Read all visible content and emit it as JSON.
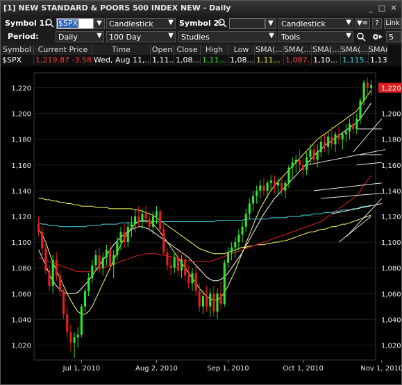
{
  "window": {
    "title": "[1] NEW STANDARD & POORS 500 INDEX NEW - Daily",
    "minimize": "_",
    "maximize": "□",
    "close": "✕"
  },
  "toolbar": {
    "symbol1_label": "Symbol 1:",
    "symbol1_value": "$SPX",
    "chart_type1": "Candlestick",
    "symbol2_label": "Symbol 2:",
    "symbol2_value": "",
    "chart_type2": "Candlestick",
    "link_label": "Link",
    "help_label": "?",
    "period_label": "Period:",
    "period_value": "Daily",
    "range_value": "100 Day",
    "studies_label": "Studies",
    "tools_label": "Tools",
    "count_value": "5"
  },
  "quote": {
    "headers": [
      "Symbol",
      "Current Price",
      "Time",
      "Open",
      "Close",
      "High",
      "Low",
      "SMA(...",
      "SMA(...",
      "SMA(...",
      "SMA(...",
      "SMA(..."
    ],
    "values": [
      "$SPX",
      "1,219.87  -3.58...",
      "Wed, Aug 11,...",
      "1,11...",
      "1,08...",
      "1,11...",
      "1,08...",
      "1,11...",
      "1,087...",
      "1,10...",
      "1,115...",
      "1,13..."
    ],
    "value_colors": [
      "#ffffff",
      "#ff3b3b",
      "#ffffff",
      "#ffffff",
      "#ffffff",
      "#2ee82e",
      "#ffffff",
      "#e8e84a",
      "#ff4040",
      "#ffffff",
      "#3fd8e0",
      "#ffffff"
    ]
  },
  "chart_data": {
    "type": "candlestick",
    "y_ticks": [
      1020,
      1040,
      1060,
      1080,
      1100,
      1120,
      1140,
      1160,
      1180,
      1200,
      1220
    ],
    "y_tick_labels": [
      "1,020",
      "1,040",
      "1,060",
      "1,080",
      "1,100",
      "1,120",
      "1,140",
      "1,160",
      "1,180",
      "1,200",
      "1,220"
    ],
    "ylim": [
      1010,
      1230
    ],
    "x_labels": [
      "Jul 1, 2010",
      "Aug 2, 2010",
      "Sep 1, 2010",
      "Oct 1, 2010",
      "Nov 1, 2010"
    ],
    "x_label_index": [
      12,
      33,
      53,
      74,
      96
    ],
    "last_price_label": "1,220",
    "last_price": 1220,
    "up_color": "#2ee82e",
    "down_color": "#e82020",
    "candles": [
      [
        1114,
        1120,
        1105,
        1108
      ],
      [
        1108,
        1112,
        1090,
        1095
      ],
      [
        1095,
        1100,
        1075,
        1078
      ],
      [
        1078,
        1082,
        1062,
        1066
      ],
      [
        1066,
        1090,
        1060,
        1086
      ],
      [
        1086,
        1092,
        1070,
        1074
      ],
      [
        1074,
        1078,
        1058,
        1062
      ],
      [
        1062,
        1064,
        1040,
        1044
      ],
      [
        1044,
        1050,
        1025,
        1030
      ],
      [
        1030,
        1036,
        1015,
        1022
      ],
      [
        1022,
        1030,
        1010,
        1026
      ],
      [
        1026,
        1034,
        1018,
        1028
      ],
      [
        1028,
        1052,
        1026,
        1050
      ],
      [
        1050,
        1064,
        1046,
        1062
      ],
      [
        1062,
        1076,
        1058,
        1072
      ],
      [
        1072,
        1086,
        1068,
        1082
      ],
      [
        1082,
        1094,
        1078,
        1090
      ],
      [
        1090,
        1096,
        1076,
        1080
      ],
      [
        1080,
        1092,
        1074,
        1088
      ],
      [
        1088,
        1098,
        1082,
        1094
      ],
      [
        1094,
        1100,
        1078,
        1082
      ],
      [
        1082,
        1094,
        1072,
        1090
      ],
      [
        1090,
        1104,
        1086,
        1100
      ],
      [
        1100,
        1112,
        1094,
        1108
      ],
      [
        1108,
        1114,
        1096,
        1100
      ],
      [
        1100,
        1116,
        1096,
        1112
      ],
      [
        1112,
        1120,
        1104,
        1114
      ],
      [
        1114,
        1126,
        1108,
        1120
      ],
      [
        1120,
        1128,
        1112,
        1116
      ],
      [
        1116,
        1126,
        1110,
        1122
      ],
      [
        1122,
        1128,
        1114,
        1118
      ],
      [
        1118,
        1124,
        1108,
        1112
      ],
      [
        1112,
        1124,
        1106,
        1120
      ],
      [
        1120,
        1128,
        1114,
        1124
      ],
      [
        1124,
        1126,
        1106,
        1110
      ],
      [
        1110,
        1114,
        1090,
        1092
      ],
      [
        1092,
        1096,
        1078,
        1082
      ],
      [
        1082,
        1088,
        1074,
        1080
      ],
      [
        1080,
        1092,
        1076,
        1088
      ],
      [
        1088,
        1094,
        1074,
        1078
      ],
      [
        1078,
        1090,
        1072,
        1086
      ],
      [
        1086,
        1092,
        1070,
        1074
      ],
      [
        1074,
        1082,
        1064,
        1068
      ],
      [
        1068,
        1080,
        1062,
        1076
      ],
      [
        1076,
        1082,
        1058,
        1062
      ],
      [
        1062,
        1068,
        1046,
        1050
      ],
      [
        1050,
        1062,
        1044,
        1058
      ],
      [
        1058,
        1066,
        1046,
        1050
      ],
      [
        1050,
        1064,
        1042,
        1060
      ],
      [
        1060,
        1066,
        1042,
        1046
      ],
      [
        1046,
        1064,
        1040,
        1060
      ],
      [
        1060,
        1070,
        1048,
        1052
      ],
      [
        1052,
        1086,
        1050,
        1084
      ],
      [
        1084,
        1096,
        1080,
        1092
      ],
      [
        1092,
        1100,
        1086,
        1096
      ],
      [
        1096,
        1104,
        1088,
        1100
      ],
      [
        1100,
        1110,
        1094,
        1106
      ],
      [
        1106,
        1116,
        1100,
        1112
      ],
      [
        1112,
        1126,
        1108,
        1122
      ],
      [
        1122,
        1134,
        1118,
        1130
      ],
      [
        1130,
        1140,
        1124,
        1136
      ],
      [
        1136,
        1144,
        1130,
        1140
      ],
      [
        1140,
        1148,
        1134,
        1144
      ],
      [
        1144,
        1150,
        1136,
        1140
      ],
      [
        1140,
        1148,
        1134,
        1146
      ],
      [
        1146,
        1152,
        1140,
        1148
      ],
      [
        1148,
        1152,
        1138,
        1144
      ],
      [
        1144,
        1150,
        1136,
        1146
      ],
      [
        1146,
        1150,
        1136,
        1140
      ],
      [
        1140,
        1148,
        1134,
        1146
      ],
      [
        1146,
        1160,
        1142,
        1158
      ],
      [
        1158,
        1166,
        1150,
        1162
      ],
      [
        1162,
        1168,
        1154,
        1164
      ],
      [
        1164,
        1172,
        1156,
        1160
      ],
      [
        1160,
        1166,
        1150,
        1156
      ],
      [
        1156,
        1170,
        1152,
        1166
      ],
      [
        1166,
        1176,
        1160,
        1172
      ],
      [
        1172,
        1178,
        1160,
        1164
      ],
      [
        1164,
        1176,
        1158,
        1170
      ],
      [
        1170,
        1182,
        1166,
        1178
      ],
      [
        1178,
        1184,
        1170,
        1174
      ],
      [
        1174,
        1186,
        1168,
        1182
      ],
      [
        1182,
        1190,
        1172,
        1176
      ],
      [
        1176,
        1186,
        1170,
        1184
      ],
      [
        1184,
        1190,
        1176,
        1180
      ],
      [
        1180,
        1186,
        1172,
        1184
      ],
      [
        1184,
        1192,
        1178,
        1186
      ],
      [
        1186,
        1196,
        1180,
        1192
      ],
      [
        1192,
        1200,
        1184,
        1188
      ],
      [
        1188,
        1200,
        1184,
        1196
      ],
      [
        1196,
        1212,
        1192,
        1210
      ],
      [
        1210,
        1226,
        1206,
        1224
      ],
      [
        1224,
        1228,
        1214,
        1220
      ],
      [
        1220,
        1226,
        1214,
        1222
      ]
    ],
    "sma_series": [
      {
        "color": "#ffffff",
        "values": [
          1094,
          1088,
          1082,
          1075,
          1070,
          1066,
          1063,
          1061,
          1060,
          1060,
          1060,
          1061,
          1064,
          1067,
          1070,
          1074,
          1078,
          1082,
          1086,
          1090,
          1094,
          1098,
          1101,
          1104,
          1106,
          1108,
          1110,
          1111,
          1112,
          1112,
          1111,
          1110,
          1108,
          1106,
          1104,
          1102,
          1100,
          1098,
          1096,
          1094,
          1092,
          1090,
          1088,
          1085,
          1082,
          1079,
          1076,
          1073,
          1071,
          1070,
          1070,
          1071,
          1073,
          1076,
          1080,
          1084,
          1088,
          1092,
          1097,
          1102,
          1107,
          1112,
          1117,
          1122,
          1126,
          1130,
          1134,
          1137,
          1140,
          1143,
          1146,
          1149,
          1152,
          1155,
          1158,
          1161,
          1164,
          1167,
          1170,
          1172,
          1175,
          1177,
          1179,
          1181,
          1183,
          1185,
          1187,
          1189,
          1191,
          1193,
          1196,
          1200,
          1204,
          1208
        ]
      },
      {
        "color": "#ffff66",
        "values": [
          1110,
          1106,
          1100,
          1092,
          1084,
          1078,
          1072,
          1066,
          1060,
          1055,
          1050,
          1046,
          1044,
          1044,
          1046,
          1050,
          1056,
          1062,
          1068,
          1074,
          1080,
          1086,
          1092,
          1098,
          1103,
          1107,
          1111,
          1114,
          1116,
          1117,
          1117,
          1116,
          1114,
          1111,
          1108,
          1104,
          1100,
          1096,
          1092,
          1088,
          1084,
          1080,
          1076,
          1072,
          1068,
          1064,
          1061,
          1058,
          1056,
          1055,
          1055,
          1057,
          1061,
          1066,
          1072,
          1078,
          1085,
          1092,
          1099,
          1106,
          1113,
          1120,
          1126,
          1131,
          1136,
          1140,
          1144,
          1147,
          1150,
          1153,
          1156,
          1159,
          1162,
          1165,
          1168,
          1171,
          1174,
          1177,
          1180,
          1182,
          1184,
          1186,
          1188,
          1190,
          1192,
          1194,
          1196,
          1198,
          1200,
          1202,
          1206,
          1210,
          1214,
          1218
        ]
      },
      {
        "color": "#ffff66",
        "values": [
          1134,
          1134,
          1133,
          1133,
          1132,
          1132,
          1131,
          1131,
          1130,
          1130,
          1129,
          1129,
          1128,
          1128,
          1128,
          1128,
          1127,
          1127,
          1127,
          1127,
          1126,
          1126,
          1126,
          1126,
          1126,
          1126,
          1126,
          1125,
          1125,
          1124,
          1123,
          1122,
          1121,
          1119,
          1117,
          1115,
          1113,
          1111,
          1109,
          1107,
          1105,
          1103,
          1101,
          1099,
          1097,
          1095,
          1094,
          1093,
          1092,
          1091,
          1091,
          1091,
          1091,
          1092,
          1093,
          1094,
          1095,
          1096,
          1096,
          1097,
          1097,
          1098,
          1098,
          1098,
          1099,
          1099,
          1100,
          1100,
          1101,
          1101,
          1102,
          1103,
          1104,
          1105,
          1106,
          1107,
          1108,
          1108,
          1109,
          1110,
          1110,
          1111,
          1112,
          1112,
          1113,
          1114,
          1114,
          1115,
          1116,
          1117,
          1118,
          1119,
          1120,
          1121
        ]
      },
      {
        "color": "#e02020",
        "values": [
          1088,
          1087,
          1086,
          1085,
          1084,
          1083,
          1082,
          1081,
          1080,
          1079,
          1078,
          1077,
          1077,
          1077,
          1077,
          1078,
          1078,
          1079,
          1080,
          1081,
          1082,
          1083,
          1084,
          1085,
          1086,
          1087,
          1088,
          1089,
          1090,
          1090,
          1091,
          1091,
          1091,
          1091,
          1090,
          1090,
          1089,
          1089,
          1088,
          1087,
          1087,
          1086,
          1086,
          1085,
          1085,
          1085,
          1085,
          1085,
          1085,
          1086,
          1087,
          1088,
          1089,
          1090,
          1091,
          1092,
          1093,
          1094,
          1095,
          1096,
          1097,
          1098,
          1099,
          1100,
          1101,
          1102,
          1103,
          1104,
          1105,
          1106,
          1107,
          1108,
          1109,
          1110,
          1111,
          1112,
          1113,
          1114,
          1115,
          1116,
          1118,
          1120,
          1122,
          1124,
          1126,
          1128,
          1130,
          1132,
          1134,
          1136,
          1140,
          1144,
          1148,
          1152
        ]
      },
      {
        "color": "#3fd8e0",
        "values": [
          1115,
          1114,
          1114,
          1113,
          1113,
          1113,
          1112,
          1112,
          1112,
          1112,
          1112,
          1112,
          1112,
          1112,
          1113,
          1113,
          1113,
          1113,
          1114,
          1114,
          1114,
          1114,
          1114,
          1115,
          1115,
          1115,
          1115,
          1115,
          1116,
          1116,
          1116,
          1116,
          1116,
          1116,
          1116,
          1116,
          1116,
          1116,
          1116,
          1116,
          1116,
          1116,
          1116,
          1116,
          1116,
          1116,
          1116,
          1116,
          1116,
          1116,
          1117,
          1117,
          1117,
          1117,
          1117,
          1117,
          1117,
          1117,
          1118,
          1118,
          1118,
          1118,
          1118,
          1118,
          1118,
          1119,
          1119,
          1119,
          1119,
          1119,
          1120,
          1120,
          1120,
          1120,
          1121,
          1121,
          1121,
          1122,
          1122,
          1122,
          1123,
          1123,
          1123,
          1124,
          1124,
          1125,
          1125,
          1125,
          1126,
          1126,
          1127,
          1128,
          1128,
          1129
        ]
      }
    ],
    "trend_segments": [
      [
        88,
        1170,
        96,
        1196
      ],
      [
        75,
        1160,
        97,
        1172
      ],
      [
        77,
        1140,
        96,
        1146
      ],
      [
        79,
        1134,
        96,
        1138
      ],
      [
        82,
        1122,
        96,
        1130
      ],
      [
        86,
        1104,
        96,
        1134
      ],
      [
        84,
        1100,
        93,
        1120
      ],
      [
        89,
        1188,
        96,
        1188
      ],
      [
        89,
        1168,
        96,
        1168
      ],
      [
        89,
        1160,
        96,
        1162
      ]
    ]
  }
}
